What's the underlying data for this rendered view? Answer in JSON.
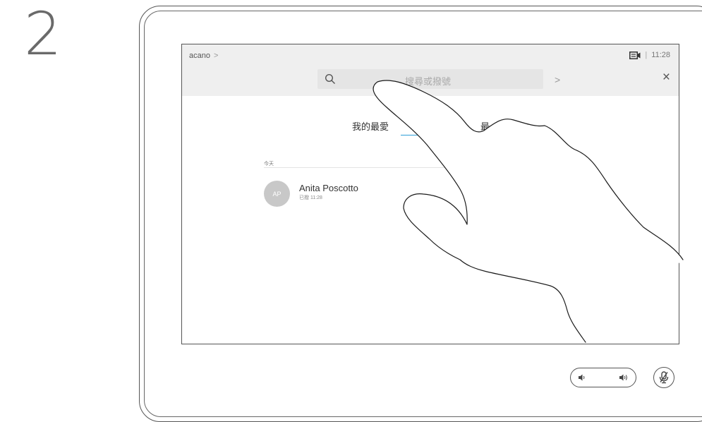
{
  "step": {
    "number": "2"
  },
  "topbar": {
    "brand": "acano",
    "brand_chevron": ">",
    "separator": "|",
    "time": "11:28"
  },
  "search": {
    "placeholder": "搜尋或撥號",
    "go_chevron": ">",
    "close": "×"
  },
  "tabs": [
    {
      "label": "我的最愛",
      "active": true
    },
    {
      "label": "最"
    }
  ],
  "recent": {
    "day_label": "今天",
    "items": [
      {
        "initials": "AP",
        "name": "Anita Poscotto",
        "detail": "已撥 11:28"
      }
    ]
  },
  "colors": {
    "accent": "#2e9fd8",
    "topbar_bg": "#efefef",
    "search_bg": "#e5e5e5",
    "avatar_bg": "#c8c8c8"
  },
  "icons": [
    "search-icon",
    "camera-status-icon",
    "close-icon",
    "volume-down-icon",
    "volume-up-icon",
    "microphone-mute-icon",
    "hand-pointer-illustration"
  ]
}
